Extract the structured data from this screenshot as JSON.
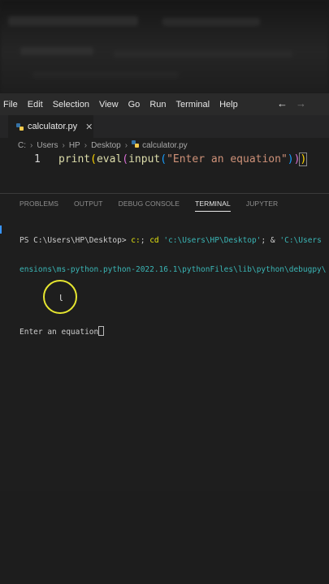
{
  "menu": {
    "items": [
      "File",
      "Edit",
      "Selection",
      "View",
      "Go",
      "Run",
      "Terminal",
      "Help"
    ],
    "back_icon": "arrow-left-icon",
    "forward_icon": "arrow-right-icon"
  },
  "tab": {
    "filename": "calculator.py",
    "close_icon": "close-icon",
    "file_icon": "python-file-icon"
  },
  "breadcrumb": {
    "parts": [
      "C:",
      "Users",
      "HP",
      "Desktop",
      "calculator.py"
    ]
  },
  "editor": {
    "line_number": "1",
    "code": {
      "fn_print": "print",
      "open1": "(",
      "fn_eval": "eval",
      "open2": "(",
      "fn_input": "input",
      "open3": "(",
      "string": "\"Enter an equation\"",
      "close3": ")",
      "close2": ")",
      "close1": ")"
    }
  },
  "panel": {
    "tabs": [
      "PROBLEMS",
      "OUTPUT",
      "DEBUG CONSOLE",
      "TERMINAL",
      "JUPYTER"
    ],
    "active_tab": "TERMINAL"
  },
  "terminal": {
    "prompt": "PS C:\\Users\\HP\\Desktop> ",
    "cmd1": "c:",
    "cmd1b": "; ",
    "cmd2": "cd",
    "arg1": " 'c:\\Users\\HP\\Desktop'",
    "cmd3": "; & ",
    "arg2": "'C:\\Users",
    "line2": "ensions\\ms-python.python-2022.16.1\\pythonFiles\\lib\\python\\debugpy\\",
    "output": "Enter an equation"
  },
  "colors": {
    "accent": "#3794ff",
    "cursor_ring": "#e6e630",
    "editor_bg": "#1e1e1e"
  }
}
